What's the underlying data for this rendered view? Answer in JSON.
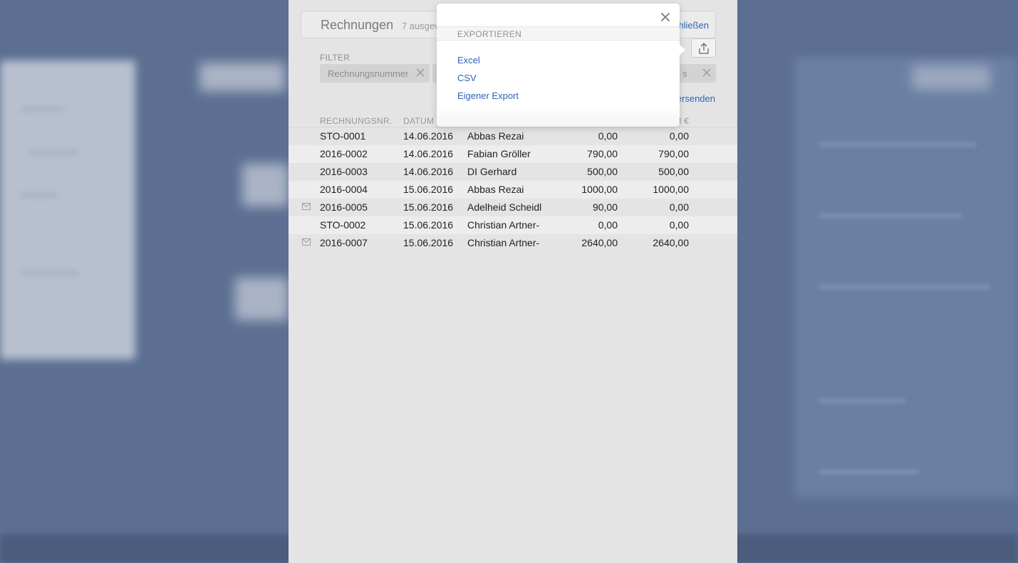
{
  "header": {
    "title": "Rechnungen",
    "subtitle": "7 ausgew",
    "close_label": "hließen"
  },
  "filter": {
    "label": "FILTER",
    "chips": [
      {
        "label": "Rechnungsnummer"
      },
      {
        "label": "s"
      }
    ]
  },
  "send_link": "ersenden",
  "table": {
    "headers": {
      "invoice_no": "RECHNUNGSNR.",
      "date": "DATUM",
      "partial": "I €"
    },
    "rows": [
      {
        "nr": "STO-0001",
        "date": "14.06.2016",
        "name": "Abbas Rezai",
        "amount": "0,00",
        "paid": "0,00",
        "mail": false
      },
      {
        "nr": "2016-0002",
        "date": "14.06.2016",
        "name": "Fabian Gröller",
        "amount": "790,00",
        "paid": "790,00",
        "mail": false
      },
      {
        "nr": "2016-0003",
        "date": "14.06.2016",
        "name": "DI Gerhard",
        "amount": "500,00",
        "paid": "500,00",
        "mail": false
      },
      {
        "nr": "2016-0004",
        "date": "15.06.2016",
        "name": "Abbas Rezai",
        "amount": "1000,00",
        "paid": "1000,00",
        "mail": false
      },
      {
        "nr": "2016-0005",
        "date": "15.06.2016",
        "name": "Adelheid Scheidl",
        "amount": "90,00",
        "paid": "0,00",
        "mail": true
      },
      {
        "nr": "STO-0002",
        "date": "15.06.2016",
        "name": "Christian Artner-",
        "amount": "0,00",
        "paid": "0,00",
        "mail": false
      },
      {
        "nr": "2016-0007",
        "date": "15.06.2016",
        "name": "Christian Artner-",
        "amount": "2640,00",
        "paid": "2640,00",
        "mail": true
      }
    ]
  },
  "popup": {
    "heading": "EXPORTIEREN",
    "items": [
      {
        "label": "Excel"
      },
      {
        "label": "CSV"
      },
      {
        "label": "Eigener Export"
      }
    ]
  },
  "colors": {
    "link": "#2f63b5",
    "backdrop": "#5c6f92",
    "panel": "#e4e4e4"
  }
}
